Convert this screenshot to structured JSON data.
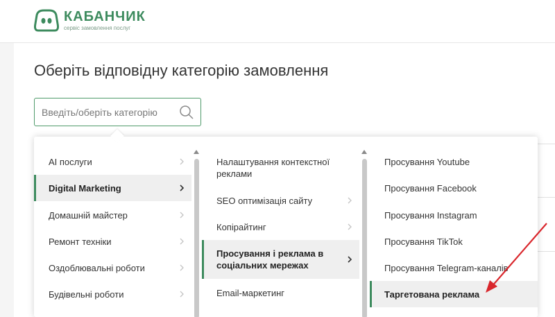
{
  "header": {
    "logo_name": "КАБАНЧИК",
    "logo_tagline": "сервіс замовлення послуг",
    "brand_color": "#3d8b5e"
  },
  "page": {
    "title": "Оберіть відповідну категорію замовлення"
  },
  "search": {
    "placeholder": "Введіть/оберіть категорію",
    "value": "",
    "icon": "search-icon"
  },
  "categories": {
    "column1": [
      {
        "label": "AI послуги",
        "selected": false
      },
      {
        "label": "Digital Marketing",
        "selected": true
      },
      {
        "label": "Домашній майстер",
        "selected": false
      },
      {
        "label": "Ремонт техніки",
        "selected": false
      },
      {
        "label": "Оздоблювальні роботи",
        "selected": false
      },
      {
        "label": "Будівельні роботи",
        "selected": false
      }
    ],
    "column2": [
      {
        "label": "Налаштування контекстної реклами",
        "selected": false
      },
      {
        "label": "SEO оптимізація сайту",
        "selected": false
      },
      {
        "label": "Копірайтинг",
        "selected": false
      },
      {
        "label": "Просування і реклама в соціальних мережах",
        "selected": true
      },
      {
        "label": "Email-маркетинг",
        "selected": false
      }
    ],
    "column3": [
      {
        "label": "Просування Youtube",
        "selected": false
      },
      {
        "label": "Просування Facebook",
        "selected": false
      },
      {
        "label": "Просування Instagram",
        "selected": false
      },
      {
        "label": "Просування TikTok",
        "selected": false
      },
      {
        "label": "Просування Telegram-каналів",
        "selected": false
      },
      {
        "label": "Таргетована реклама",
        "selected": true
      }
    ]
  },
  "annotation": {
    "arrow_color": "#d9262c"
  }
}
